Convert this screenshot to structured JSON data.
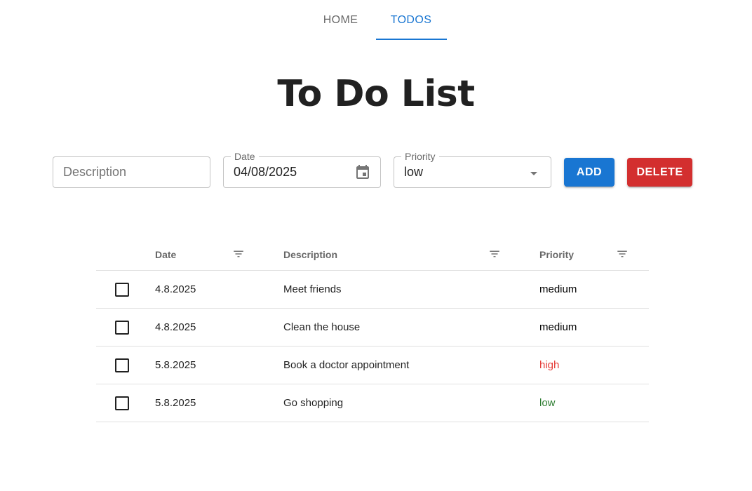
{
  "nav": {
    "tabs": [
      {
        "label": "HOME",
        "active": false
      },
      {
        "label": "TODOS",
        "active": true
      }
    ]
  },
  "page": {
    "title": "To Do List"
  },
  "form": {
    "description": {
      "placeholder": "Description",
      "value": ""
    },
    "date": {
      "label": "Date",
      "value": "04/08/2025",
      "icon": "calendar-icon"
    },
    "priority": {
      "label": "Priority",
      "value": "low",
      "icon": "chevron-down-icon"
    },
    "add_label": "ADD",
    "delete_label": "DELETE"
  },
  "colors": {
    "primary": "#1976d2",
    "danger": "#d32f2f",
    "priority_high": "#e53935",
    "priority_low": "#2e7d32",
    "priority_medium": "#000000"
  },
  "table": {
    "columns": [
      "Date",
      "Description",
      "Priority"
    ],
    "rows": [
      {
        "checked": false,
        "date": "4.8.2025",
        "description": "Meet friends",
        "priority": "medium"
      },
      {
        "checked": false,
        "date": "4.8.2025",
        "description": "Clean the house",
        "priority": "medium"
      },
      {
        "checked": false,
        "date": "5.8.2025",
        "description": "Book a doctor appointment",
        "priority": "high"
      },
      {
        "checked": false,
        "date": "5.8.2025",
        "description": "Go shopping",
        "priority": "low"
      }
    ]
  }
}
